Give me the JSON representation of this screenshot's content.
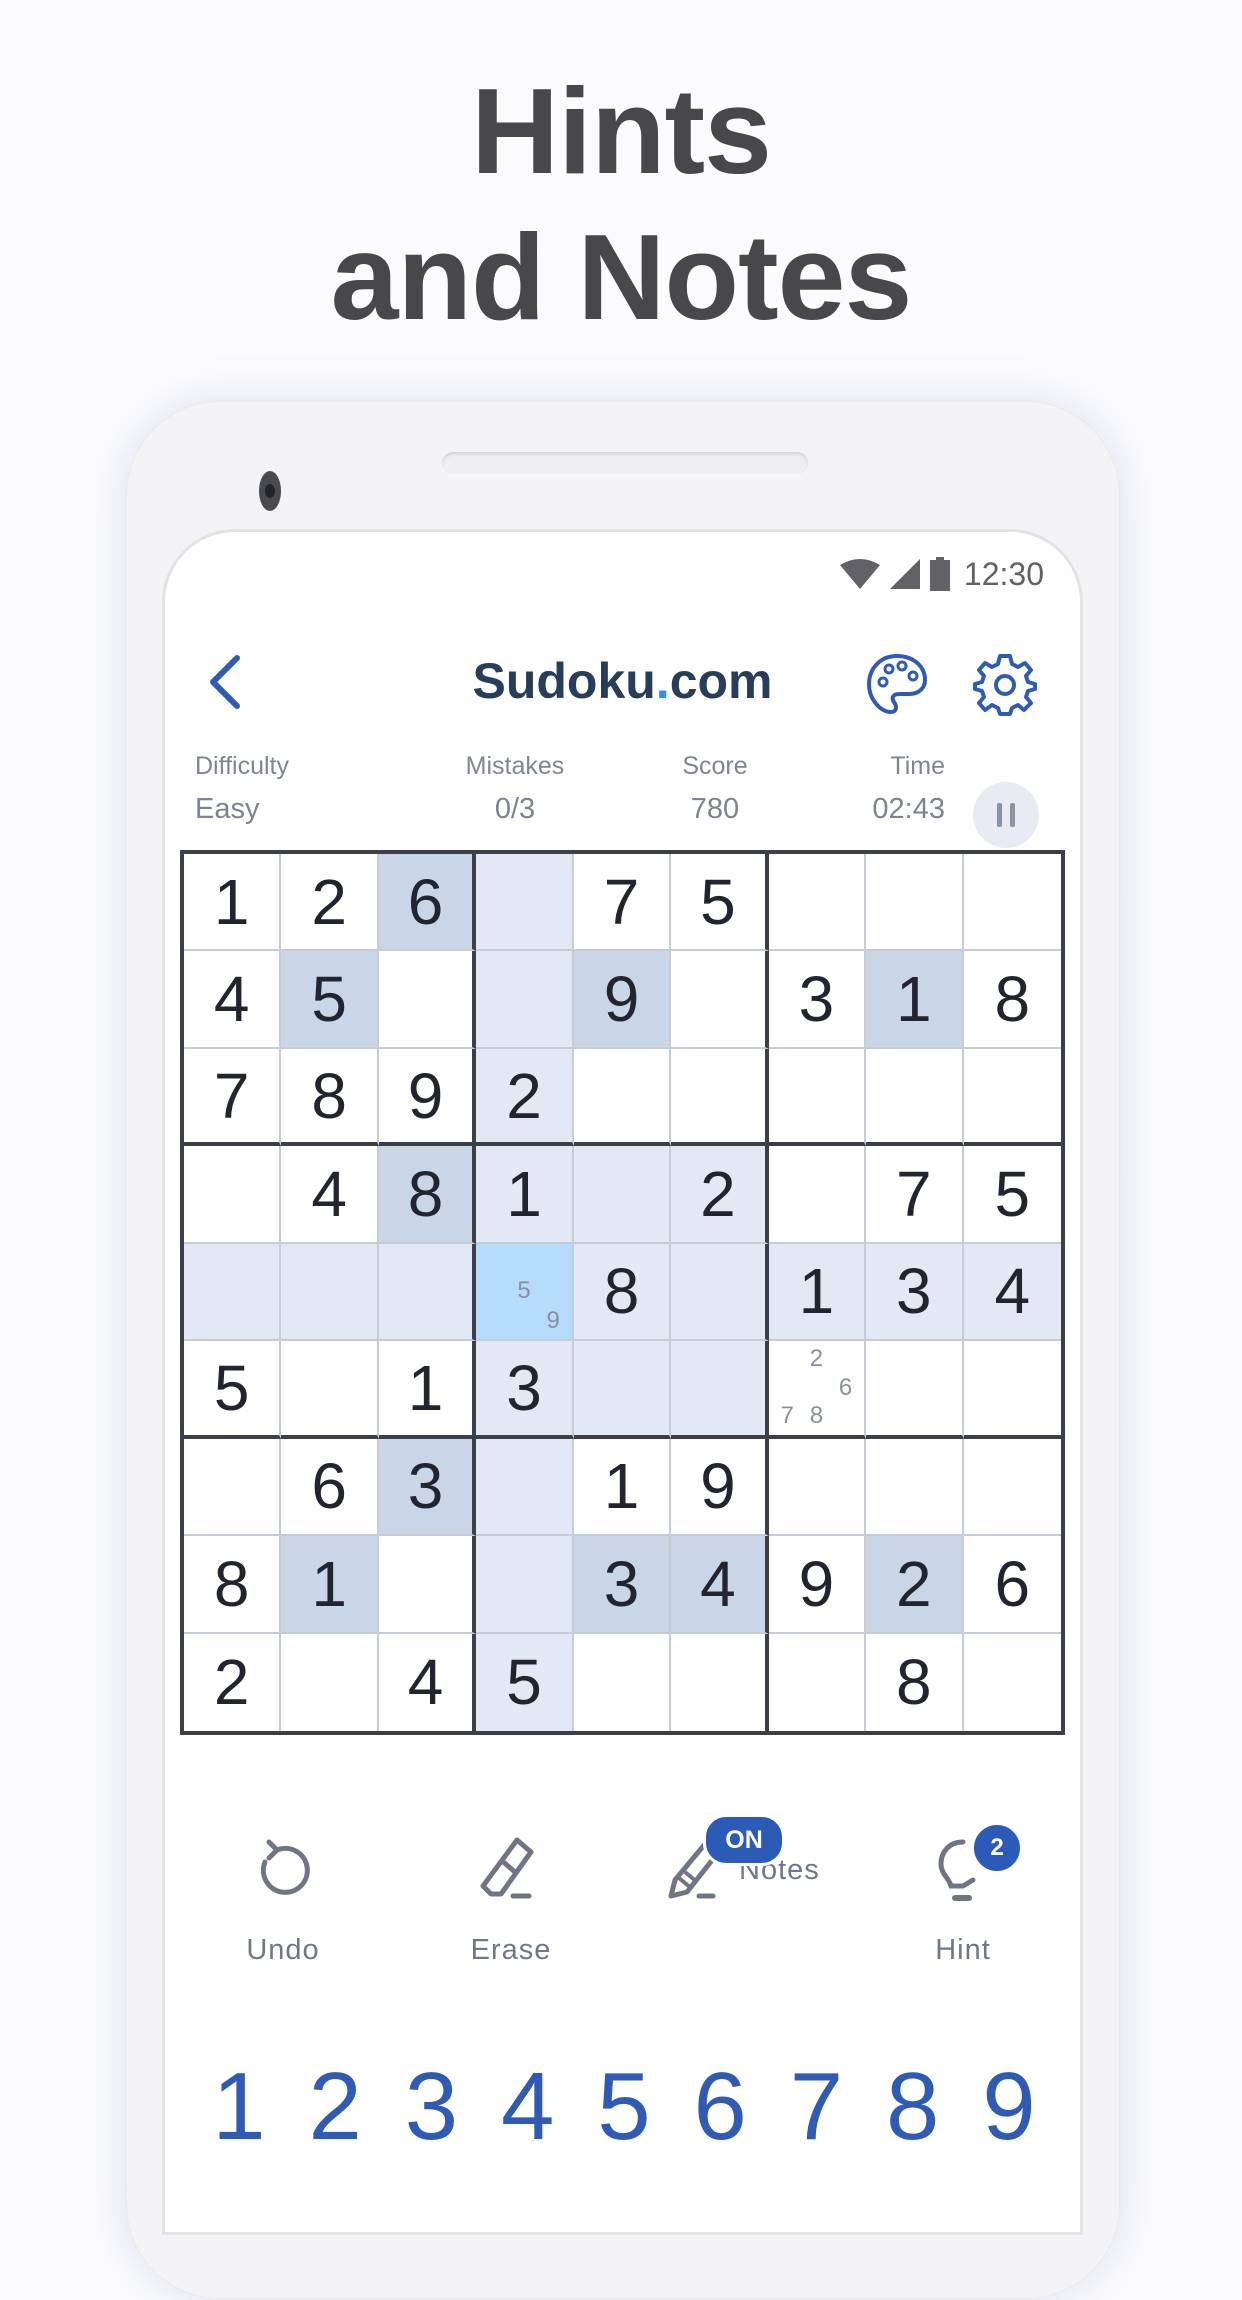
{
  "headline": {
    "line1": "Hints",
    "line2": "and Notes"
  },
  "status_bar": {
    "time": "12:30",
    "icons": [
      "wifi-icon",
      "signal-icon",
      "battery-icon"
    ]
  },
  "header": {
    "back_icon": "chevron-left-icon",
    "title_main": "Sudoku",
    "title_dot": ".",
    "title_suffix": "com",
    "palette_icon": "palette-icon",
    "settings_icon": "gear-icon"
  },
  "stats": {
    "difficulty": {
      "label": "Difficulty",
      "value": "Easy"
    },
    "mistakes": {
      "label": "Mistakes",
      "value": "0/3"
    },
    "score": {
      "label": "Score",
      "value": "780"
    },
    "time": {
      "label": "Time",
      "value": "02:43"
    },
    "pause_icon": "pause-icon"
  },
  "colors": {
    "accent": "#2b5bb6",
    "title": "#263d5c",
    "title_dot": "#2e8ef5",
    "cell_light": "#e2e9f4",
    "cell_dark": "#c8d6e8",
    "cell_selected": "#b6dcfb"
  },
  "grid": {
    "selected": [
      4,
      3
    ],
    "values": [
      [
        1,
        2,
        6,
        0,
        7,
        5,
        0,
        0,
        0
      ],
      [
        4,
        5,
        0,
        0,
        9,
        0,
        3,
        1,
        8
      ],
      [
        7,
        8,
        9,
        2,
        0,
        0,
        0,
        0,
        0
      ],
      [
        0,
        4,
        8,
        1,
        0,
        2,
        0,
        7,
        5
      ],
      [
        0,
        0,
        0,
        0,
        8,
        0,
        1,
        3,
        4
      ],
      [
        5,
        0,
        1,
        3,
        0,
        0,
        0,
        0,
        0
      ],
      [
        0,
        6,
        3,
        0,
        1,
        9,
        0,
        0,
        0
      ],
      [
        8,
        1,
        0,
        0,
        3,
        4,
        9,
        2,
        6
      ],
      [
        2,
        0,
        4,
        5,
        0,
        0,
        0,
        8,
        0
      ]
    ],
    "highlight": [
      [
        "",
        "",
        "dark",
        "light",
        "",
        "",
        "",
        "",
        ""
      ],
      [
        "",
        "dark",
        "",
        "light",
        "dark",
        "",
        "",
        "dark",
        ""
      ],
      [
        "",
        "",
        "",
        "light",
        "",
        "",
        "",
        "",
        ""
      ],
      [
        "",
        "",
        "dark",
        "light",
        "light",
        "light",
        "",
        "",
        ""
      ],
      [
        "light",
        "light",
        "light",
        "selected",
        "light",
        "light",
        "light",
        "light",
        "light"
      ],
      [
        "",
        "",
        "",
        "light",
        "light",
        "light",
        "",
        "",
        ""
      ],
      [
        "",
        "",
        "dark",
        "light",
        "",
        "",
        "",
        "",
        ""
      ],
      [
        "",
        "dark",
        "",
        "light",
        "dark",
        "dark",
        "",
        "dark",
        ""
      ],
      [
        "",
        "",
        "",
        "light",
        "",
        "",
        "",
        "",
        ""
      ]
    ],
    "notes": [
      {
        "row": 4,
        "col": 3,
        "digits": [
          5,
          9
        ]
      },
      {
        "row": 5,
        "col": 6,
        "digits": [
          2,
          6,
          7,
          8
        ]
      }
    ]
  },
  "toolbar": {
    "undo": {
      "label": "Undo",
      "icon": "undo-icon"
    },
    "erase": {
      "label": "Erase",
      "icon": "eraser-icon"
    },
    "notes": {
      "label": "Notes",
      "icon": "pencil-icon",
      "badge": "ON"
    },
    "hint": {
      "label": "Hint",
      "icon": "lightbulb-icon",
      "badge": "2"
    }
  },
  "numpad": [
    "1",
    "2",
    "3",
    "4",
    "5",
    "6",
    "7",
    "8",
    "9"
  ]
}
